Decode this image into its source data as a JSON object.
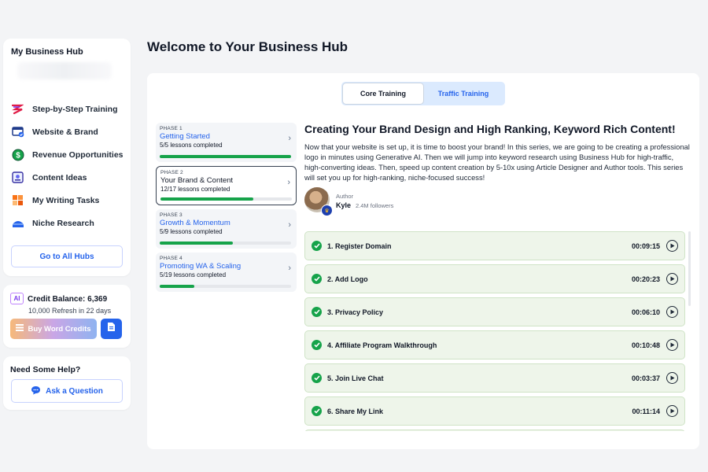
{
  "sidebar": {
    "title": "My Business Hub",
    "items": [
      {
        "label": "Step-by-Step Training",
        "icon": "steps-icon"
      },
      {
        "label": "Website & Brand",
        "icon": "website-icon"
      },
      {
        "label": "Revenue Opportunities",
        "icon": "dollar-icon"
      },
      {
        "label": "Content Ideas",
        "icon": "ideas-icon"
      },
      {
        "label": "My Writing Tasks",
        "icon": "tasks-icon"
      },
      {
        "label": "Niche Research",
        "icon": "research-icon"
      }
    ],
    "hubs_button": "Go to All Hubs"
  },
  "credits": {
    "badge": "AI",
    "balance": "Credit Balance: 6,369",
    "refresh": "10,000 Refresh in 22 days",
    "buy_button": "Buy Word Credits"
  },
  "help": {
    "title": "Need Some Help?",
    "ask_button": "Ask a Question"
  },
  "page": {
    "title": "Welcome to Your Business Hub"
  },
  "tabs": [
    {
      "label": "Core Training",
      "active": true
    },
    {
      "label": "Traffic Training",
      "active": false
    }
  ],
  "phases": [
    {
      "tag": "PHASE 1",
      "name": "Getting Started",
      "count": "5/5 lessons completed",
      "progress": 1.0
    },
    {
      "tag": "PHASE 2",
      "name": "Your Brand & Content",
      "count": "12/17 lessons completed",
      "progress": 0.706
    },
    {
      "tag": "PHASE 3",
      "name": "Growth & Momentum",
      "count": "5/9 lessons completed",
      "progress": 0.556
    },
    {
      "tag": "PHASE 4",
      "name": "Promoting WA & Scaling",
      "count": "5/19 lessons completed",
      "progress": 0.263
    }
  ],
  "series": {
    "title": "Creating Your Brand Design and High Ranking, Keyword Rich Content!",
    "description": "Now that your website is set up, it is time to boost your brand! In this series, we are going to be creating a professional logo in minutes using Generative AI. Then we will jump into keyword research using Business Hub for high-traffic, high-converting ideas. Then, speed up content creation by 5-10x using Article Designer and Author tools. This series will set you up for high-ranking, niche-focused success!",
    "author_label": "Author",
    "author_name": "Kyle",
    "author_followers": "2.4M followers"
  },
  "lessons": [
    {
      "name": "1. Register Domain",
      "time": "00:09:15"
    },
    {
      "name": "2. Add Logo",
      "time": "00:20:23"
    },
    {
      "name": "3. Privacy Policy",
      "time": "00:06:10"
    },
    {
      "name": "4. Affiliate Program Walkthrough",
      "time": "00:10:48"
    },
    {
      "name": "5. Join Live Chat",
      "time": "00:03:37"
    },
    {
      "name": "6. Share My Link",
      "time": "00:11:14"
    },
    {
      "name": "",
      "time": ""
    }
  ],
  "colors": {
    "accent": "#2563eb",
    "success": "#16a34a",
    "lesson_bg": "#eef5ea"
  }
}
